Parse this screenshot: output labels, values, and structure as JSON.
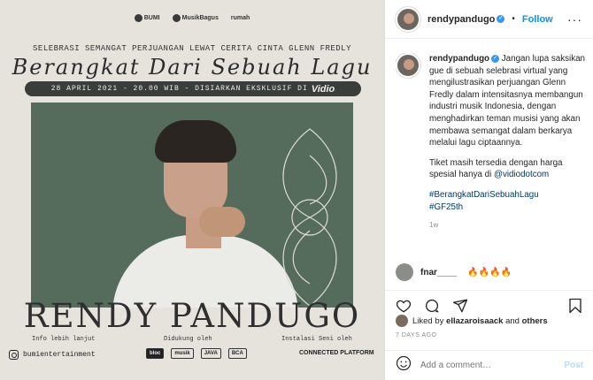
{
  "poster": {
    "logos": [
      "BUMI",
      "MusikBagus",
      "rumah"
    ],
    "subtitle": "SELEBRASI SEMANGAT PERJUANGAN LEWAT CERITA CINTA GLENN FREDLY",
    "headline": "Berangkat Dari Sebuah Lagu",
    "date_line": "28 APRIL 2021 - 20.00 WIB - DISIARKAN EKSKLUSIF DI",
    "vidio": "Vidio",
    "artist_name": "RENDY PANDUGO",
    "info_label": "Info lebih lanjut",
    "instagram_handle": "bumientertainment",
    "supported_label": "Didukung oleh",
    "sponsors": [
      "bloc",
      "musik",
      "JAVA",
      "BCA"
    ],
    "art_label": "Instalasi Seni oleh",
    "art_partner": "CONNECTED PLATFORM"
  },
  "header": {
    "username": "rendypandugo",
    "follow_label": "Follow",
    "more_icon": "ellipsis-icon"
  },
  "caption": {
    "username": "rendypandugo",
    "body": "Jangan lupa saksikan gue di sebuah selebrasi virtual yang mengilustrasikan perjuangan Glenn Fredly dalam intensitasnya membangun industri musik Indonesia, dengan menghadirkan teman musisi yang akan membawa semangat dalam berkarya melalui lagu ciptaannya.",
    "tickets": "Tiket masih tersedia dengan harga spesial hanya di",
    "mention": "@vidiodotcom",
    "hashtag1": "#BerangkatDariSebuahLagu",
    "hashtag2": "#GF25th",
    "age": "1w"
  },
  "comment": {
    "username": "fnar____",
    "text": "🔥🔥🔥🔥"
  },
  "likes": {
    "prefix": "Liked by",
    "user": "ellazaroisaack",
    "and": "and",
    "others": "others"
  },
  "date": "7 DAYS AGO",
  "add_comment": {
    "placeholder": "Add a comment…",
    "post_label": "Post"
  },
  "colors": {
    "accent": "#0095f6",
    "poster_bg": "#e6e3dc",
    "photo_bg": "#556b5b"
  }
}
